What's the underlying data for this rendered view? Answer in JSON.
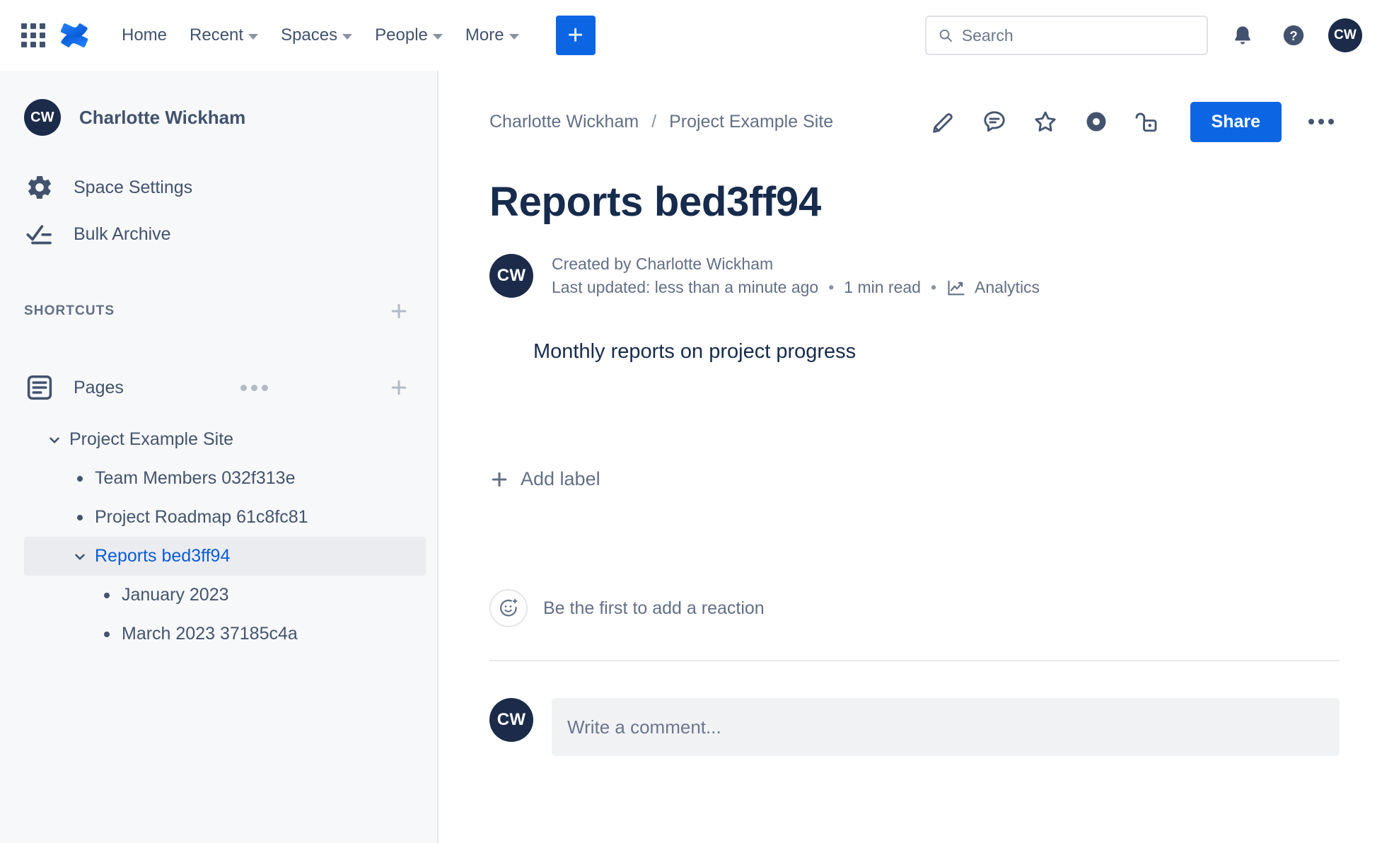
{
  "topnav": {
    "apps_icon": "app-switcher-icon",
    "logo_icon": "confluence-logo-icon",
    "links": [
      {
        "label": "Home",
        "has_chevron": false
      },
      {
        "label": "Recent",
        "has_chevron": true
      },
      {
        "label": "Spaces",
        "has_chevron": true
      },
      {
        "label": "People",
        "has_chevron": true
      },
      {
        "label": "More",
        "has_chevron": true
      }
    ],
    "create_label": "+",
    "search": {
      "placeholder": "Search",
      "value": "",
      "icon": "search-icon"
    },
    "notifications_icon": "bell-icon",
    "help_icon": "question-circle-icon",
    "profile_initials": "CW"
  },
  "sidebar": {
    "space": {
      "initials": "CW",
      "name": "Charlotte Wickham"
    },
    "items": [
      {
        "label": "Space Settings",
        "icon": "gear-icon"
      },
      {
        "label": "Bulk Archive",
        "icon": "checklist-icon"
      }
    ],
    "shortcuts": {
      "title": "SHORTCUTS",
      "add_icon": "plus-icon"
    },
    "pages": {
      "label": "Pages",
      "icon": "pages-icon",
      "more_icon": "ellipsis-icon",
      "add_icon": "plus-icon"
    },
    "tree": [
      {
        "label": "Project Example Site",
        "level": 1,
        "marker": "twisty-down",
        "active": false,
        "link": false
      },
      {
        "label": "Team Members 032f313e",
        "level": 2,
        "marker": "bullet",
        "active": false,
        "link": false
      },
      {
        "label": "Project Roadmap 61c8fc81",
        "level": 2,
        "marker": "bullet",
        "active": false,
        "link": false
      },
      {
        "label": "Reports bed3ff94",
        "level": 2,
        "marker": "twisty-down",
        "active": true,
        "link": true
      },
      {
        "label": "January 2023",
        "level": 3,
        "marker": "bullet",
        "active": false,
        "link": false
      },
      {
        "label": "March 2023 37185c4a",
        "level": 3,
        "marker": "bullet",
        "active": false,
        "link": false
      }
    ]
  },
  "main": {
    "breadcrumb": {
      "root": "Charlotte Wickham",
      "separator": "/",
      "space": "Project Example Site"
    },
    "actions": [
      {
        "name": "edit-icon"
      },
      {
        "name": "comment-icon"
      },
      {
        "name": "star-icon"
      },
      {
        "name": "watch-icon"
      },
      {
        "name": "unlock-icon"
      }
    ],
    "share_label": "Share",
    "more_icon": "ellipsis-icon",
    "title": "Reports bed3ff94",
    "author": {
      "initials": "CW",
      "created_by": "Created by Charlotte Wickham"
    },
    "last_updated": "Last updated: less than a minute ago",
    "read_time": "1 min read",
    "analytics_label": "Analytics",
    "dot": "•",
    "content": "Monthly reports on project progress",
    "add_label": "Add label",
    "reaction_text": "Be the first to add a reaction",
    "comment": {
      "initials": "CW",
      "placeholder": "Write a comment...",
      "value": ""
    }
  },
  "colors": {
    "brand_blue": "#0c66e4",
    "link_blue": "#0b5cd5",
    "text_dark": "#172b4d",
    "text_muted": "#626f86",
    "sidebar_bg": "#f7f8f9",
    "selected_bg": "#ebecf0"
  }
}
